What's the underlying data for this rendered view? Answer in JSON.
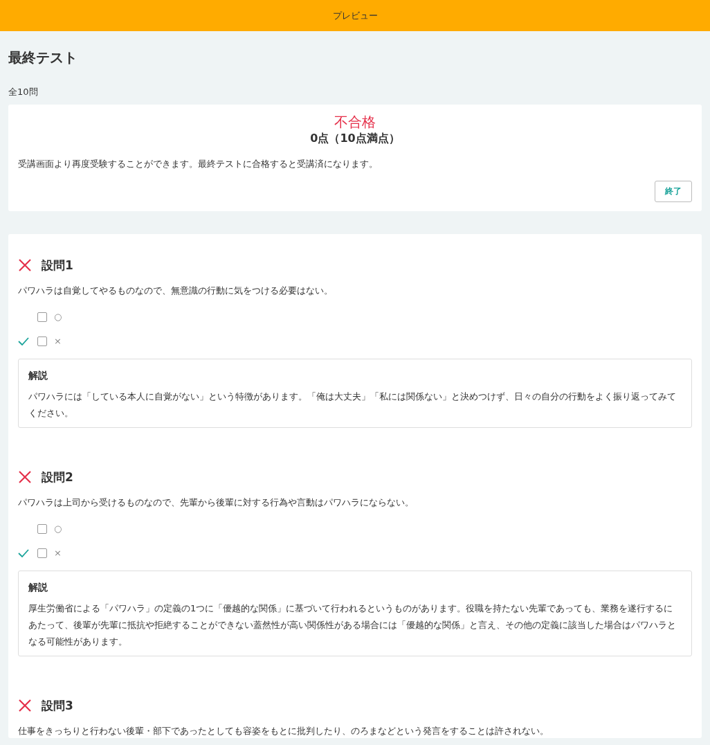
{
  "header": {
    "title": "プレビュー"
  },
  "page_title": "最終テスト",
  "question_count": "全10問",
  "result": {
    "status": "不合格",
    "passed": false,
    "score": "0点（10点満点）",
    "message": "受講画面より再度受験することができます。最終テストに合格すると受講済になります。",
    "button": "終了"
  },
  "questions": [
    {
      "title": "設問1",
      "correct": false,
      "text": "パワハラは自覚してやるものなので、無意識の行動に気をつける必要はない。",
      "options": [
        {
          "label": "○",
          "checked": false,
          "answer": false
        },
        {
          "label": "×",
          "checked": false,
          "answer": true
        }
      ],
      "explanation": {
        "title": "解説",
        "text": "パワハラには「している本人に自覚がない」という特徴があります。「俺は大丈夫」「私には関係ない」と決めつけず、日々の自分の行動をよく振り返ってみてください。"
      }
    },
    {
      "title": "設問2",
      "correct": false,
      "text": "パワハラは上司から受けるものなので、先輩から後輩に対する行為や言動はパワハラにならない。",
      "options": [
        {
          "label": "○",
          "checked": false,
          "answer": false
        },
        {
          "label": "×",
          "checked": false,
          "answer": true
        }
      ],
      "explanation": {
        "title": "解説",
        "text": "厚生労働省による「パワハラ」の定義の1つに「優越的な関係」に基づいて行われるというものがあります。役職を持たない先輩であっても、業務を遂行するにあたって、後輩が先輩に抵抗や拒絶することができない蓋然性が高い関係性がある場合には「優越的な関係」と言え、その他の定義に該当した場合はパワハラとなる可能性があります。"
      }
    },
    {
      "title": "設問3",
      "correct": false,
      "text": "仕事をきっちりと行わない後輩・部下であったとしても容姿をもとに批判したり、のろまなどという発言をすることは許されない。"
    }
  ]
}
